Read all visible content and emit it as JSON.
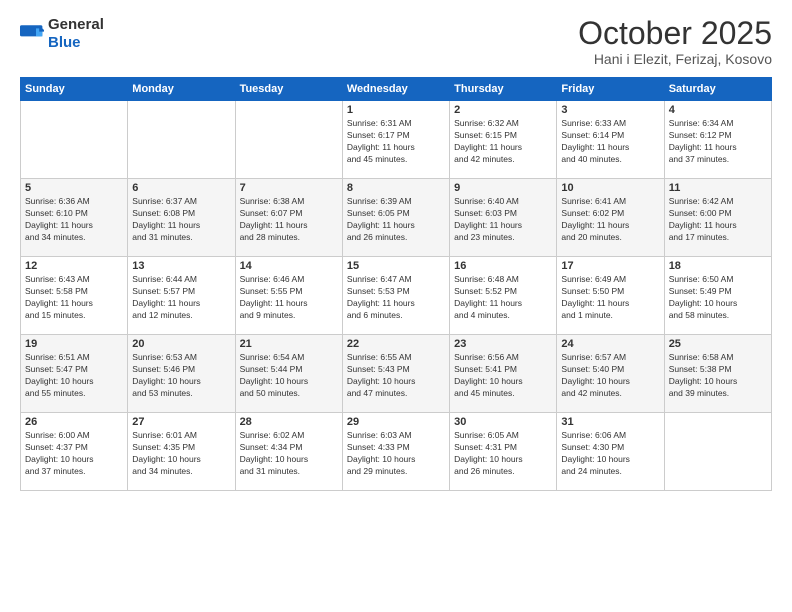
{
  "header": {
    "logo_general": "General",
    "logo_blue": "Blue",
    "month": "October 2025",
    "location": "Hani i Elezit, Ferizaj, Kosovo"
  },
  "weekdays": [
    "Sunday",
    "Monday",
    "Tuesday",
    "Wednesday",
    "Thursday",
    "Friday",
    "Saturday"
  ],
  "weeks": [
    [
      {
        "day": "",
        "info": ""
      },
      {
        "day": "",
        "info": ""
      },
      {
        "day": "",
        "info": ""
      },
      {
        "day": "1",
        "info": "Sunrise: 6:31 AM\nSunset: 6:17 PM\nDaylight: 11 hours\nand 45 minutes."
      },
      {
        "day": "2",
        "info": "Sunrise: 6:32 AM\nSunset: 6:15 PM\nDaylight: 11 hours\nand 42 minutes."
      },
      {
        "day": "3",
        "info": "Sunrise: 6:33 AM\nSunset: 6:14 PM\nDaylight: 11 hours\nand 40 minutes."
      },
      {
        "day": "4",
        "info": "Sunrise: 6:34 AM\nSunset: 6:12 PM\nDaylight: 11 hours\nand 37 minutes."
      }
    ],
    [
      {
        "day": "5",
        "info": "Sunrise: 6:36 AM\nSunset: 6:10 PM\nDaylight: 11 hours\nand 34 minutes."
      },
      {
        "day": "6",
        "info": "Sunrise: 6:37 AM\nSunset: 6:08 PM\nDaylight: 11 hours\nand 31 minutes."
      },
      {
        "day": "7",
        "info": "Sunrise: 6:38 AM\nSunset: 6:07 PM\nDaylight: 11 hours\nand 28 minutes."
      },
      {
        "day": "8",
        "info": "Sunrise: 6:39 AM\nSunset: 6:05 PM\nDaylight: 11 hours\nand 26 minutes."
      },
      {
        "day": "9",
        "info": "Sunrise: 6:40 AM\nSunset: 6:03 PM\nDaylight: 11 hours\nand 23 minutes."
      },
      {
        "day": "10",
        "info": "Sunrise: 6:41 AM\nSunset: 6:02 PM\nDaylight: 11 hours\nand 20 minutes."
      },
      {
        "day": "11",
        "info": "Sunrise: 6:42 AM\nSunset: 6:00 PM\nDaylight: 11 hours\nand 17 minutes."
      }
    ],
    [
      {
        "day": "12",
        "info": "Sunrise: 6:43 AM\nSunset: 5:58 PM\nDaylight: 11 hours\nand 15 minutes."
      },
      {
        "day": "13",
        "info": "Sunrise: 6:44 AM\nSunset: 5:57 PM\nDaylight: 11 hours\nand 12 minutes."
      },
      {
        "day": "14",
        "info": "Sunrise: 6:46 AM\nSunset: 5:55 PM\nDaylight: 11 hours\nand 9 minutes."
      },
      {
        "day": "15",
        "info": "Sunrise: 6:47 AM\nSunset: 5:53 PM\nDaylight: 11 hours\nand 6 minutes."
      },
      {
        "day": "16",
        "info": "Sunrise: 6:48 AM\nSunset: 5:52 PM\nDaylight: 11 hours\nand 4 minutes."
      },
      {
        "day": "17",
        "info": "Sunrise: 6:49 AM\nSunset: 5:50 PM\nDaylight: 11 hours\nand 1 minute."
      },
      {
        "day": "18",
        "info": "Sunrise: 6:50 AM\nSunset: 5:49 PM\nDaylight: 10 hours\nand 58 minutes."
      }
    ],
    [
      {
        "day": "19",
        "info": "Sunrise: 6:51 AM\nSunset: 5:47 PM\nDaylight: 10 hours\nand 55 minutes."
      },
      {
        "day": "20",
        "info": "Sunrise: 6:53 AM\nSunset: 5:46 PM\nDaylight: 10 hours\nand 53 minutes."
      },
      {
        "day": "21",
        "info": "Sunrise: 6:54 AM\nSunset: 5:44 PM\nDaylight: 10 hours\nand 50 minutes."
      },
      {
        "day": "22",
        "info": "Sunrise: 6:55 AM\nSunset: 5:43 PM\nDaylight: 10 hours\nand 47 minutes."
      },
      {
        "day": "23",
        "info": "Sunrise: 6:56 AM\nSunset: 5:41 PM\nDaylight: 10 hours\nand 45 minutes."
      },
      {
        "day": "24",
        "info": "Sunrise: 6:57 AM\nSunset: 5:40 PM\nDaylight: 10 hours\nand 42 minutes."
      },
      {
        "day": "25",
        "info": "Sunrise: 6:58 AM\nSunset: 5:38 PM\nDaylight: 10 hours\nand 39 minutes."
      }
    ],
    [
      {
        "day": "26",
        "info": "Sunrise: 6:00 AM\nSunset: 4:37 PM\nDaylight: 10 hours\nand 37 minutes."
      },
      {
        "day": "27",
        "info": "Sunrise: 6:01 AM\nSunset: 4:35 PM\nDaylight: 10 hours\nand 34 minutes."
      },
      {
        "day": "28",
        "info": "Sunrise: 6:02 AM\nSunset: 4:34 PM\nDaylight: 10 hours\nand 31 minutes."
      },
      {
        "day": "29",
        "info": "Sunrise: 6:03 AM\nSunset: 4:33 PM\nDaylight: 10 hours\nand 29 minutes."
      },
      {
        "day": "30",
        "info": "Sunrise: 6:05 AM\nSunset: 4:31 PM\nDaylight: 10 hours\nand 26 minutes."
      },
      {
        "day": "31",
        "info": "Sunrise: 6:06 AM\nSunset: 4:30 PM\nDaylight: 10 hours\nand 24 minutes."
      },
      {
        "day": "",
        "info": ""
      }
    ]
  ]
}
